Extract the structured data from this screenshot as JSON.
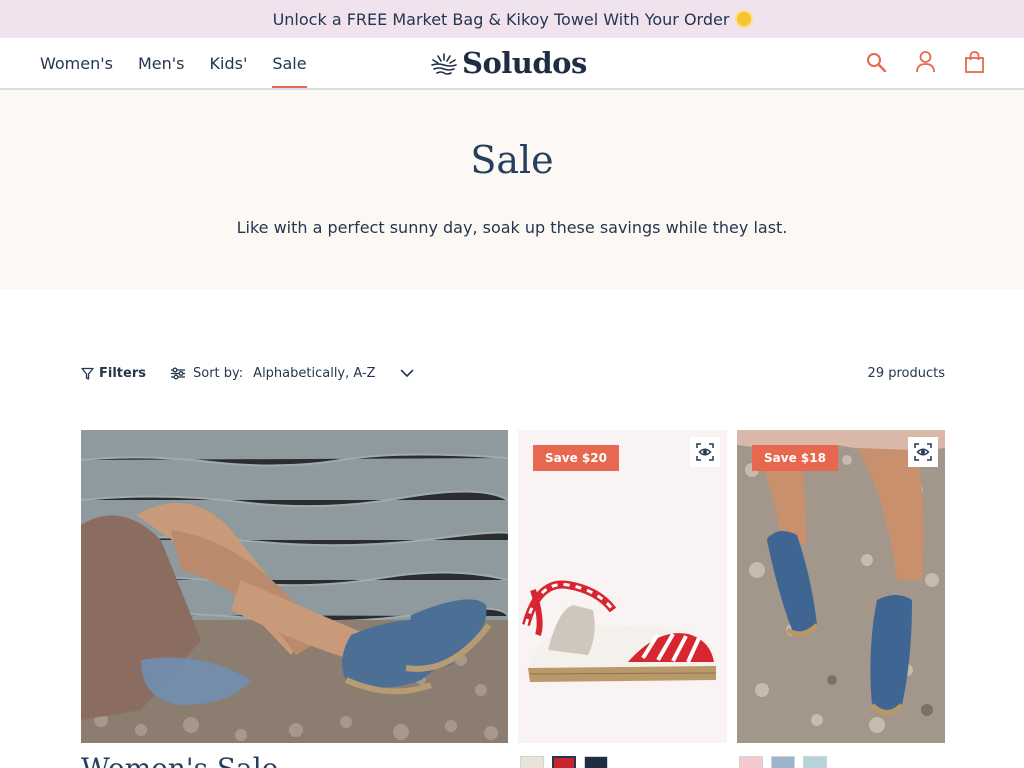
{
  "announcement": {
    "text": "Unlock a FREE Market Bag & Kikoy Towel With Your Order"
  },
  "nav": {
    "items": [
      "Women's",
      "Men's",
      "Kids'",
      "Sale"
    ],
    "active": "Sale"
  },
  "logo": {
    "text": "Soludos"
  },
  "header_icons": [
    "search-icon",
    "account-icon",
    "cart-icon"
  ],
  "hero": {
    "title": "Sale",
    "subtitle": "Like with a perfect sunny day, soak up these savings while they last."
  },
  "toolbar": {
    "filters_label": "Filters",
    "sort_label": "Sort by:",
    "sort_value": "Alphabetically, A-Z",
    "count": "29 products"
  },
  "products": [
    {
      "badge": "Save $20"
    },
    {
      "badge": "Save $18"
    }
  ],
  "collection": {
    "title": "Women's Sale"
  },
  "colors": {
    "accent": "#e8684f",
    "announcement_bg": "#f0e3ee",
    "hero_bg": "#fcf8f4",
    "text": "#25364f"
  }
}
